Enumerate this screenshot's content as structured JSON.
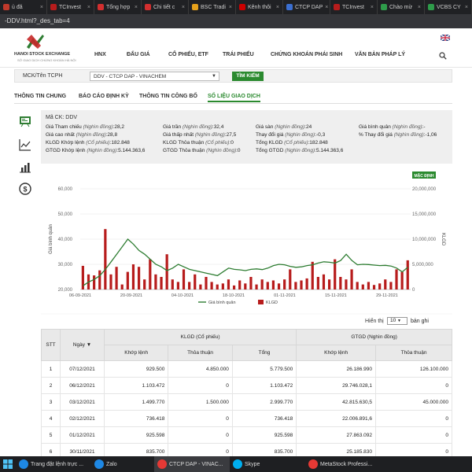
{
  "browser": {
    "tabs": [
      {
        "label": "ủ đă",
        "color": "#c0392b"
      },
      {
        "label": "TCInvest",
        "color": "#b71c1c"
      },
      {
        "label": "Tổng hợp",
        "color": "#d32f2f"
      },
      {
        "label": "Chi tiết c",
        "color": "#d32f2f"
      },
      {
        "label": "BSC Tradi",
        "color": "#e6a11b"
      },
      {
        "label": "Kênh thôi",
        "color": "#cc0000"
      },
      {
        "label": "CTCP DAP",
        "color": "#3b6fd1"
      },
      {
        "label": "TCInvest",
        "color": "#b71c1c"
      },
      {
        "label": "Chào mừ",
        "color": "#2e9c4a"
      },
      {
        "label": "VCBS CY",
        "color": "#2e9c4a"
      }
    ],
    "url": "-DDV.html?_des_tab=4"
  },
  "site": {
    "logo_text": "HANOI STOCK EXCHANGE",
    "logo_sub": "SỞ GIAO DỊCH CHỨNG KHOÁN HÀ NỘI",
    "nav": [
      "HNX",
      "ĐẤU GIÁ",
      "CỔ PHIẾU, ETF",
      "TRÁI PHIẾU",
      "CHỨNG KHOÁN PHÁI SINH",
      "VĂN BẢN PHÁP LÝ"
    ]
  },
  "search": {
    "label": "MCK/Tên TCPH",
    "selected": "DDV - CTCP DAP - VINACHEM",
    "button": "TÌM KIẾM"
  },
  "subtabs": [
    "THÔNG TIN CHUNG",
    "BÁO CÁO ĐỊNH KỲ",
    "THÔNG TIN CÔNG BỐ",
    "SỐ LIỆU GIAO DỊCH"
  ],
  "info": {
    "ma_ck": "Mã CK: DDV",
    "stats": [
      {
        "label": "Giá Tham chiếu",
        "unit": "(Nghìn đồng)",
        "value": ":28,2"
      },
      {
        "label": "Giá trần",
        "unit": "(Nghìn đồng)",
        "value": ":32,4"
      },
      {
        "label": "Giá sàn",
        "unit": "(Nghìn đồng)",
        "value": ":24"
      },
      {
        "label": "Giá bình quân",
        "unit": "(Nghìn đồng)",
        "value": ":-"
      },
      {
        "label": "Giá cao nhất",
        "unit": "(Nghìn đồng)",
        "value": ":28,8"
      },
      {
        "label": "Giá thấp nhất",
        "unit": "(Nghìn đồng)",
        "value": ":27,5"
      },
      {
        "label": "Thay đổi giá",
        "unit": "(Nghìn đồng)",
        "value": ":-0,3"
      },
      {
        "label": "% Thay đổi giá",
        "unit": "(Nghìn đồng)",
        "value": ":-1,06"
      },
      {
        "label": "KLGD Khớp lệnh",
        "unit": "(Cổ phiếu)",
        "value": ":182.848"
      },
      {
        "label": "KLGD Thỏa thuận",
        "unit": "(Cổ phiếu)",
        "value": ":0"
      },
      {
        "label": "Tổng KLGD",
        "unit": "(Cổ phiếu)",
        "value": ":182.848"
      },
      {
        "label": "GTGD Khớp lệnh",
        "unit": "(Nghìn đồng)",
        "value": ":5.144.363,6"
      },
      {
        "label": "GTGD Thỏa thuận",
        "unit": "(Nghìn đồng)",
        "value": ":0"
      },
      {
        "label": "Tổng GTGD",
        "unit": "(Nghìn đồng)",
        "value": ":5.144.363,6"
      }
    ]
  },
  "chart_data": {
    "type": "line",
    "badge": "MẶC ĐỊNH",
    "ylabel_left": "Giá bình quân",
    "ylabel_right": "KLGD",
    "y_left_ticks": [
      "60,000",
      "50,000",
      "40,000",
      "30,000",
      "20,000"
    ],
    "y_right_ticks": [
      "20,000,000",
      "15,000,000",
      "10,000,000",
      "5,000,000",
      "0"
    ],
    "ylim_left": [
      20000,
      60000
    ],
    "ylim_right": [
      0,
      20000000
    ],
    "x_ticks": [
      "06-09-2021",
      "20-09-2021",
      "04-10-2021",
      "18-10-2021",
      "01-11-2021",
      "15-11-2021",
      "29-11-2021"
    ],
    "series": [
      {
        "name": "Giá bình quân",
        "color": "#2e7d32",
        "values": [
          21500,
          23000,
          24000,
          25500,
          28000,
          31000,
          34000,
          37000,
          40000,
          38000,
          35500,
          34000,
          32000,
          30000,
          29000,
          27500,
          28500,
          30000,
          29000,
          28000,
          27500,
          27000,
          26500,
          26000,
          25500,
          27000,
          28500,
          28000,
          27800,
          27500,
          28000,
          28200,
          27900,
          28500,
          29500,
          30000,
          29800,
          29200,
          28800,
          29000,
          29500,
          29800,
          30500,
          31000,
          30800,
          30500,
          31500,
          34000,
          31500,
          29800,
          30000,
          29900,
          29700,
          29500,
          29600,
          29300,
          28500,
          27000,
          28800
        ]
      },
      {
        "name": "KLGD",
        "color": "#b71c1c",
        "values": [
          4700000,
          3000000,
          2800000,
          3800000,
          12000000,
          3000000,
          4500000,
          1000000,
          3500000,
          5000000,
          4500000,
          2000000,
          6000000,
          3000000,
          2500000,
          7000000,
          2000000,
          1500000,
          4000000,
          1500000,
          3000000,
          1000000,
          2500000,
          1500000,
          1000000,
          1200000,
          2000000,
          800000,
          1800000,
          1200000,
          2500000,
          1000000,
          2000000,
          1500000,
          1800000,
          1200000,
          2000000,
          4000000,
          1500000,
          1800000,
          2200000,
          5500000,
          2500000,
          3000000,
          2000000,
          6000000,
          2500000,
          2000000,
          4000000,
          1500000,
          1000000,
          1500000,
          900000,
          1200000,
          2000000,
          1500000,
          4000000,
          3500000,
          5800000
        ]
      }
    ],
    "legend": [
      "Giá bình quân",
      "KLGD"
    ]
  },
  "table_controls": {
    "hien_thi": "Hiển thị",
    "page_size": "10",
    "ban_ghi": "bản ghi"
  },
  "table": {
    "header_top": [
      "STT",
      "Ngày ▼",
      "KLGD (Cổ phiếu)",
      "GTGD (Nghìn đồng)"
    ],
    "header_sub": [
      "Khớp lệnh",
      "Thỏa thuận",
      "Tổng",
      "Khớp lệnh",
      "Thỏa thuận"
    ],
    "rows": [
      [
        "1",
        "07/12/2021",
        "929.500",
        "4.850.000",
        "5.779.500",
        "26.186.990",
        "126.100.000"
      ],
      [
        "2",
        "06/12/2021",
        "1.103.472",
        "0",
        "1.103.472",
        "29.746.028,1",
        "0"
      ],
      [
        "3",
        "03/12/2021",
        "1.499.770",
        "1.500.000",
        "2.999.770",
        "42.815.630,5",
        "45.000.000"
      ],
      [
        "4",
        "02/12/2021",
        "736.418",
        "0",
        "736.418",
        "22.006.891,6",
        "0"
      ],
      [
        "5",
        "01/12/2021",
        "925.598",
        "0",
        "925.598",
        "27.863.092",
        "0"
      ],
      [
        "6",
        "30/11/2021",
        "835.700",
        "0",
        "835.700",
        "25.185.830",
        "0"
      ]
    ]
  },
  "taskbar": [
    {
      "label": "Trang đặt lệnh trực ...",
      "color": "#1e88e5"
    },
    {
      "label": "Zalo",
      "color": "#1e88e5"
    },
    {
      "label": "CTCP DAP - VINAC...",
      "color": "#e53935"
    },
    {
      "label": "Skype",
      "color": "#00aff0"
    },
    {
      "label": "MetaStock Professi...",
      "color": "#e53935"
    }
  ]
}
